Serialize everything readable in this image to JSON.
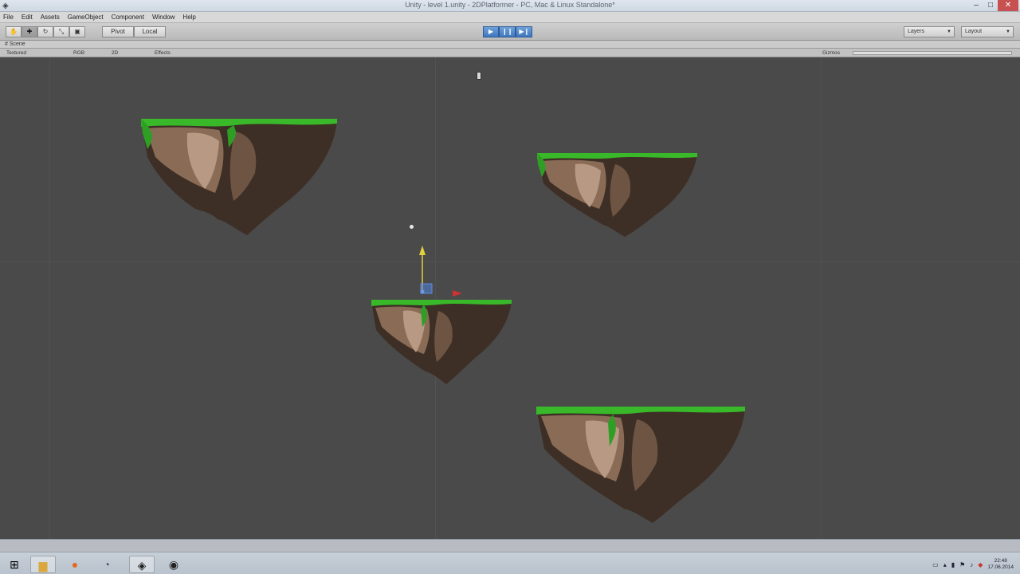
{
  "window": {
    "title": "Unity - level 1.unity - 2DPlatformer - PC, Mac & Linux Standalone*",
    "app_icon": "unity-logo-icon",
    "minimize": "–",
    "maximize": "□",
    "close": "✕"
  },
  "menu": [
    "File",
    "Edit",
    "Assets",
    "GameObject",
    "Component",
    "Window",
    "Help"
  ],
  "toolbar": {
    "tools": [
      "✋",
      "✚",
      "↻",
      "⤡",
      "▣"
    ],
    "pivot_label": "Pivot",
    "local_label": "Local",
    "play": "▶",
    "pause": "❙❙",
    "step": "▶❙",
    "layers_label": "Layers",
    "layout_label": "Layout"
  },
  "scene": {
    "tab_label": "# Scene",
    "shading_mode": "Textured",
    "mode_2d": "RGB",
    "mode_scale": "2D",
    "effects_label": "Effects",
    "gizmos_label": "Gizmos"
  },
  "taskbar": {
    "start_icon": "windows-start-icon",
    "apps": [
      "explorer-icon",
      "firefox-icon",
      "misc-app-icon",
      "unity-icon",
      "obs-icon"
    ],
    "time": "22:48",
    "date": "17.06.2014"
  },
  "colors": {
    "viewport_bg": "#4a4a4a",
    "grass": "#39b82a",
    "rock_light": "#a17e66",
    "rock_dark": "#3d2f25",
    "gizmo_y": "#e0d040",
    "gizmo_x": "#d03030"
  }
}
